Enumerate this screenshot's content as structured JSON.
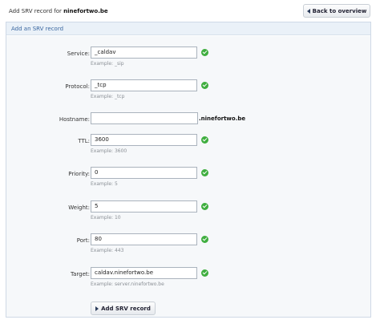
{
  "header": {
    "title_prefix": "Add SRV record for ",
    "domain": "ninefortwo.be",
    "back_label": "Back to overview"
  },
  "form": {
    "title": "Add an SRV record",
    "fields": [
      {
        "label": "Service:",
        "value": "_caldav",
        "example": "Example: _sip",
        "valid": true
      },
      {
        "label": "Protocol:",
        "value": "_tcp",
        "example": "Example: _tcp",
        "valid": true
      },
      {
        "label": "Hostname:",
        "value": "",
        "suffix": ".ninefortwo.be",
        "valid": false
      },
      {
        "label": "TTL:",
        "value": "3600",
        "example": "Example: 3600",
        "valid": true
      },
      {
        "label": "Priority:",
        "value": "0",
        "example": "Example: 5",
        "valid": true
      },
      {
        "label": "Weight:",
        "value": "5",
        "example": "Example: 10",
        "valid": true
      },
      {
        "label": "Port:",
        "value": "80",
        "example": "Example: 443",
        "valid": true
      },
      {
        "label": "Target:",
        "value": "caldav.ninefortwo.be",
        "example": "Example: server.ninefortwo.be",
        "valid": true
      }
    ],
    "submit_label": "Add SRV record"
  },
  "colors": {
    "accent": "#3a67a0",
    "valid": "#3fae3f"
  },
  "icons": {
    "back": "arrow-left-icon",
    "submit": "arrow-right-icon",
    "valid": "check-icon"
  }
}
